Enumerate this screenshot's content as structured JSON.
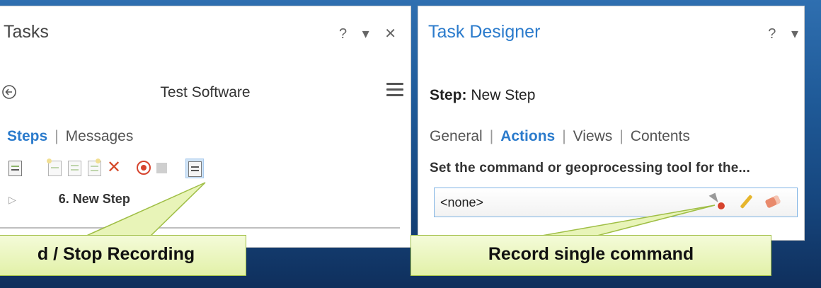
{
  "tasks_panel": {
    "title": "Tasks",
    "controls": "? ▾ ✕",
    "task_name": "Test Software",
    "tabs": [
      "Steps",
      "Messages"
    ],
    "step_label": "6.  New Step"
  },
  "designer_panel": {
    "title": "Task Designer",
    "controls": "? ▾",
    "step_prefix": "Step:",
    "step_name": "New Step",
    "tabs": [
      "General",
      "Actions",
      "Views",
      "Contents"
    ],
    "description": "Set the command or geoprocessing tool for the...",
    "command_value": "<none>"
  },
  "callouts": {
    "left": "d / Stop Recording",
    "right": "Record single command"
  },
  "colors": {
    "accent": "#2b7bcc",
    "record": "#d6442e",
    "callout_fill": "#e2f1a8"
  }
}
